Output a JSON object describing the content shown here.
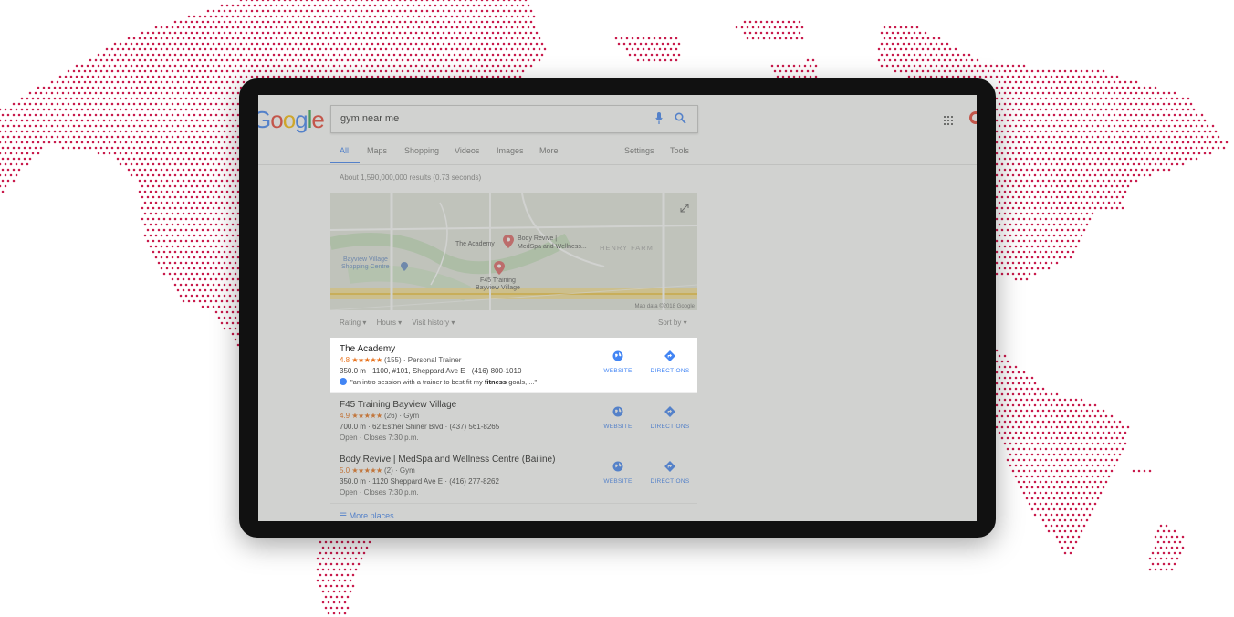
{
  "colors": {
    "dots": "#c8184a",
    "accent": "#4285f4",
    "star": "#e7711b"
  },
  "google_logo": {
    "text_parts": [
      "G",
      "o",
      "o",
      "g",
      "l",
      "e"
    ]
  },
  "search": {
    "value": "gym near me"
  },
  "tabs": [
    {
      "label": "All",
      "active": true
    },
    {
      "label": "Maps"
    },
    {
      "label": "Shopping"
    },
    {
      "label": "Videos"
    },
    {
      "label": "Images"
    },
    {
      "label": "More"
    }
  ],
  "tools": {
    "settings": "Settings",
    "tools": "Tools"
  },
  "result_stats": "About 1,590,000,000 results (0.73 seconds)",
  "map": {
    "labels": {
      "the_academy": "The Academy",
      "body_revive_1": "Body Revive |",
      "body_revive_2": "MedSpa and Wellness...",
      "henry_farm": "HENRY FARM",
      "bayview_1": "Bayview Village",
      "bayview_2": "Shopping Centre",
      "f45_1": "F45 Training",
      "f45_2": "Bayview Village"
    },
    "footer": "Map data ©2018 Google"
  },
  "filters": {
    "items": [
      "Rating ▾",
      "Hours ▾",
      "Visit history ▾"
    ],
    "sort": "Sort by ▾"
  },
  "listings": [
    {
      "name": "The Academy",
      "rating": "4.8",
      "stars": "★★★★★",
      "meta": "(155) · Personal Trainer",
      "address": "350.0 m · 1100, #101, Sheppard Ave E · (416) 800-1010",
      "quote_pre": "\"an intro session with a trainer to best fit my",
      "quote_bold": "fitness",
      "quote_post": "goals, ...\"",
      "website": "WEBSITE",
      "directions": "DIRECTIONS"
    },
    {
      "name": "F45 Training Bayview Village",
      "rating": "4.9",
      "stars": "★★★★★",
      "meta": "(26) · Gym",
      "address": "700.0 m · 62 Esther Shiner Blvd · (437) 561-8265",
      "status": "Open · Closes 7:30 p.m.",
      "website": "WEBSITE",
      "directions": "DIRECTIONS"
    },
    {
      "name": "Body Revive | MedSpa and Wellness Centre (Bailine)",
      "rating": "5.0",
      "stars": "★★★★★",
      "meta": "(2) · Gym",
      "address": "350.0 m · 1120 Sheppard Ave E · (416) 277-8262",
      "status": "Open · Closes 7:30 p.m.",
      "website": "WEBSITE",
      "directions": "DIRECTIONS"
    }
  ],
  "more_places": "More places"
}
